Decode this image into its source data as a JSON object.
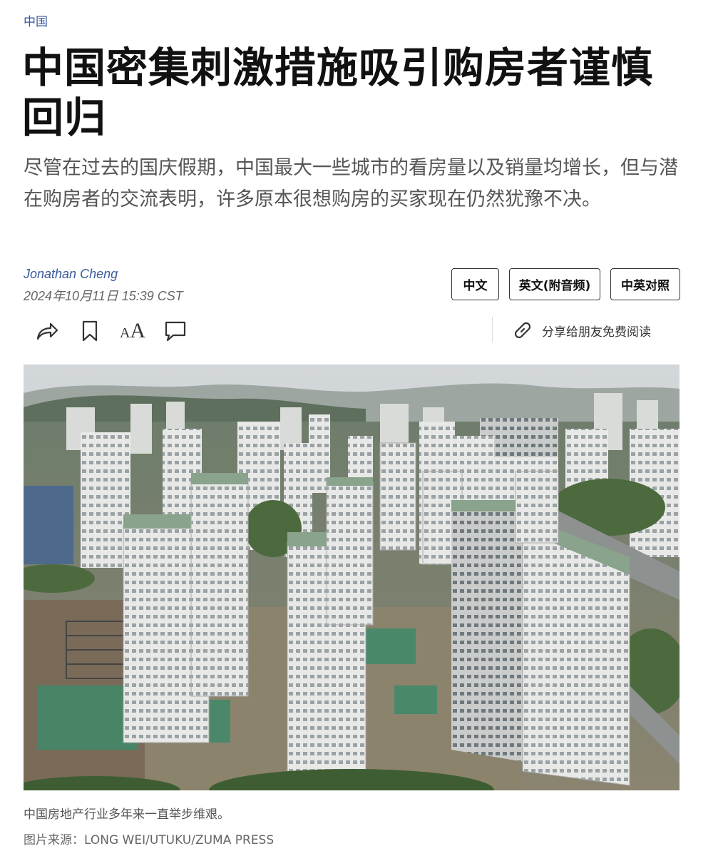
{
  "article": {
    "category": "中国",
    "headline": "中国密集刺激措施吸引购房者谨慎回归",
    "dek": "尽管在过去的国庆假期，中国最大一些城市的看房量以及销量均增长，但与潜在购房者的交流表明，许多原本很想购房的买家现在仍然犹豫不决。",
    "author": "Jonathan Cheng",
    "timestamp": "2024年10月11日 15:39 CST"
  },
  "language_buttons": {
    "chinese": "中文",
    "english": "英文(附音频)",
    "bilingual": "中英对照"
  },
  "toolbar": {
    "share_icon": "share-arrow-icon",
    "bookmark_icon": "bookmark-icon",
    "text_size_icon": "text-size-icon",
    "comment_icon": "comment-icon",
    "gift_label": "分享给朋友免费阅读",
    "gift_icon": "link-icon"
  },
  "photo": {
    "caption": "中国房地产行业多年来一直举步维艰。",
    "credit": "图片来源：LONG WEI/UTUKU/ZUMA PRESS"
  },
  "colors": {
    "accent": "#3a5a9c",
    "headline": "#111111",
    "dek": "#555555"
  }
}
